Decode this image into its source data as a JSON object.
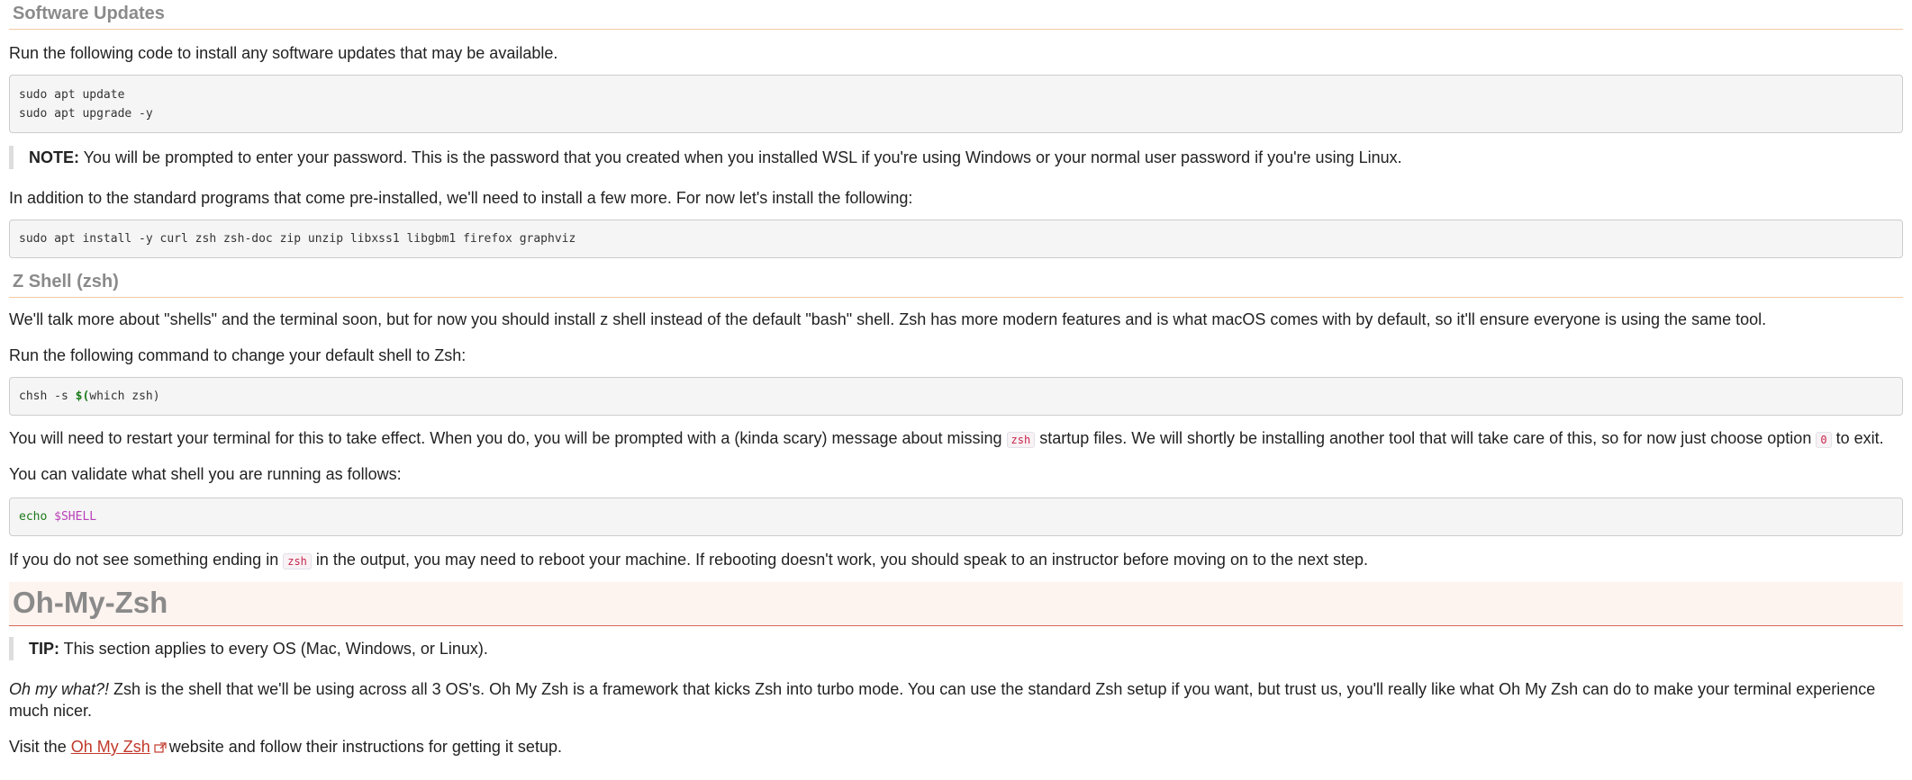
{
  "software_updates": {
    "heading": "Software Updates",
    "intro": "Run the following code to install any software updates that may be available.",
    "code_lines": [
      "sudo apt update",
      "sudo apt upgrade -y"
    ],
    "note_label": "NOTE:",
    "note_text": " You will be prompted to enter your password. This is the password that you created when you installed WSL if you're using Windows or your normal user password if you're using Linux.",
    "install_intro": "In addition to the standard programs that come pre-installed, we'll need to install a few more. For now let's install the following:",
    "install_code": "sudo apt install -y curl zsh zsh-doc zip unzip libxss1 libgbm1 firefox graphviz"
  },
  "zsh": {
    "heading": "Z Shell (zsh)",
    "intro": "We'll talk more about \"shells\" and the terminal soon, but for now you should install z shell instead of the default \"bash\" shell. Zsh has more modern features and is what macOS comes with by default, so it'll ensure everyone is using the same tool.",
    "change_intro": "Run the following command to change your default shell to Zsh:",
    "chsh_prefix": "chsh -s ",
    "chsh_dollar": "$(",
    "chsh_rest": "which zsh)",
    "restart_part1": "You will need to restart your terminal for this to take effect. When you do, you will be prompted with a (kinda scary) message about missing ",
    "restart_code1": "zsh",
    "restart_part2": " startup files. We will shortly be installing another tool that will take care of this, so for now just choose option ",
    "restart_code2": "0",
    "restart_part3": " to exit.",
    "validate_intro": "You can validate what shell you are running as follows:",
    "echo_cmd": "echo ",
    "echo_var": "$SHELL",
    "reboot_part1": "If you do not see something ending in ",
    "reboot_code": "zsh",
    "reboot_part2": " in the output, you may need to reboot your machine. If rebooting doesn't work, you should speak to an instructor before moving on to the next step."
  },
  "ohmyzsh": {
    "heading": "Oh-My-Zsh",
    "tip_label": "TIP:",
    "tip_text": " This section applies to every OS (Mac, Windows, or Linux).",
    "desc_italic": "Oh my what?!",
    "desc_text": " Zsh is the shell that we'll be using across all 3 OS's. Oh My Zsh is a framework that kicks Zsh into turbo mode. You can use the standard Zsh setup if you want, but trust us, you'll really like what Oh My Zsh can do to make your terminal experience much nicer.",
    "visit_prefix": "Visit the ",
    "link_text": "Oh My Zsh",
    "visit_suffix": " website and follow their instructions for getting it setup."
  },
  "colors": {
    "heading_gray": "#8a8a8a",
    "section_rule": "#f1c9a0",
    "big_rule": "#d9675a",
    "link_red": "#c0392b",
    "inline_code_red": "#c7254e"
  },
  "icons": {
    "external_link": "external-link-icon"
  }
}
